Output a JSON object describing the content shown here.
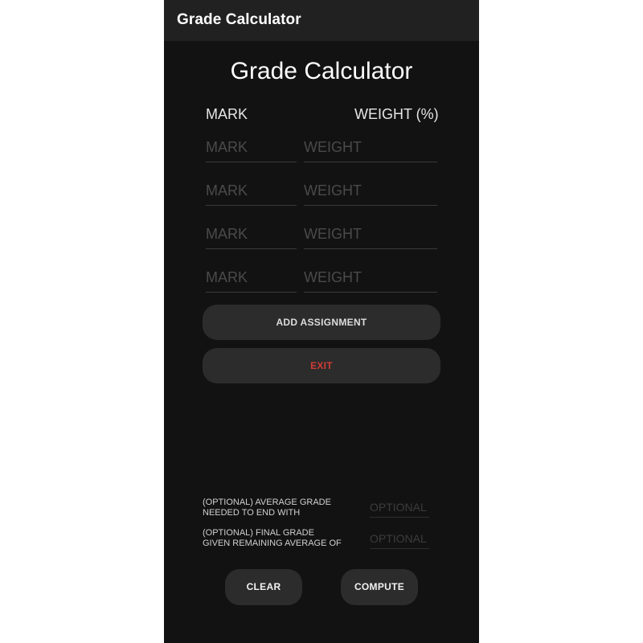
{
  "appbar": {
    "title": "Grade Calculator"
  },
  "page": {
    "title": "Grade Calculator",
    "columns": {
      "mark": "MARK",
      "weight": "WEIGHT (%)"
    }
  },
  "rows": [
    {
      "mark_placeholder": "MARK",
      "weight_placeholder": "WEIGHT"
    },
    {
      "mark_placeholder": "MARK",
      "weight_placeholder": "WEIGHT"
    },
    {
      "mark_placeholder": "MARK",
      "weight_placeholder": "WEIGHT"
    },
    {
      "mark_placeholder": "MARK",
      "weight_placeholder": "WEIGHT"
    }
  ],
  "buttons": {
    "add_assignment": "ADD ASSIGNMENT",
    "exit": "EXIT",
    "clear": "CLEAR",
    "compute": "COMPUTE"
  },
  "optional": {
    "average_label_1": "(OPTIONAL) AVERAGE GRADE",
    "average_label_2": "NEEDED TO END WITH",
    "average_placeholder": "OPTIONAL",
    "final_label_1": "(OPTIONAL) FINAL GRADE",
    "final_label_2": "GIVEN REMAINING AVERAGE OF",
    "final_placeholder": "OPTIONAL"
  },
  "colors": {
    "background": "#121212",
    "appbar": "#212121",
    "button": "#2c2c2c",
    "exit_text": "#d23b35"
  }
}
